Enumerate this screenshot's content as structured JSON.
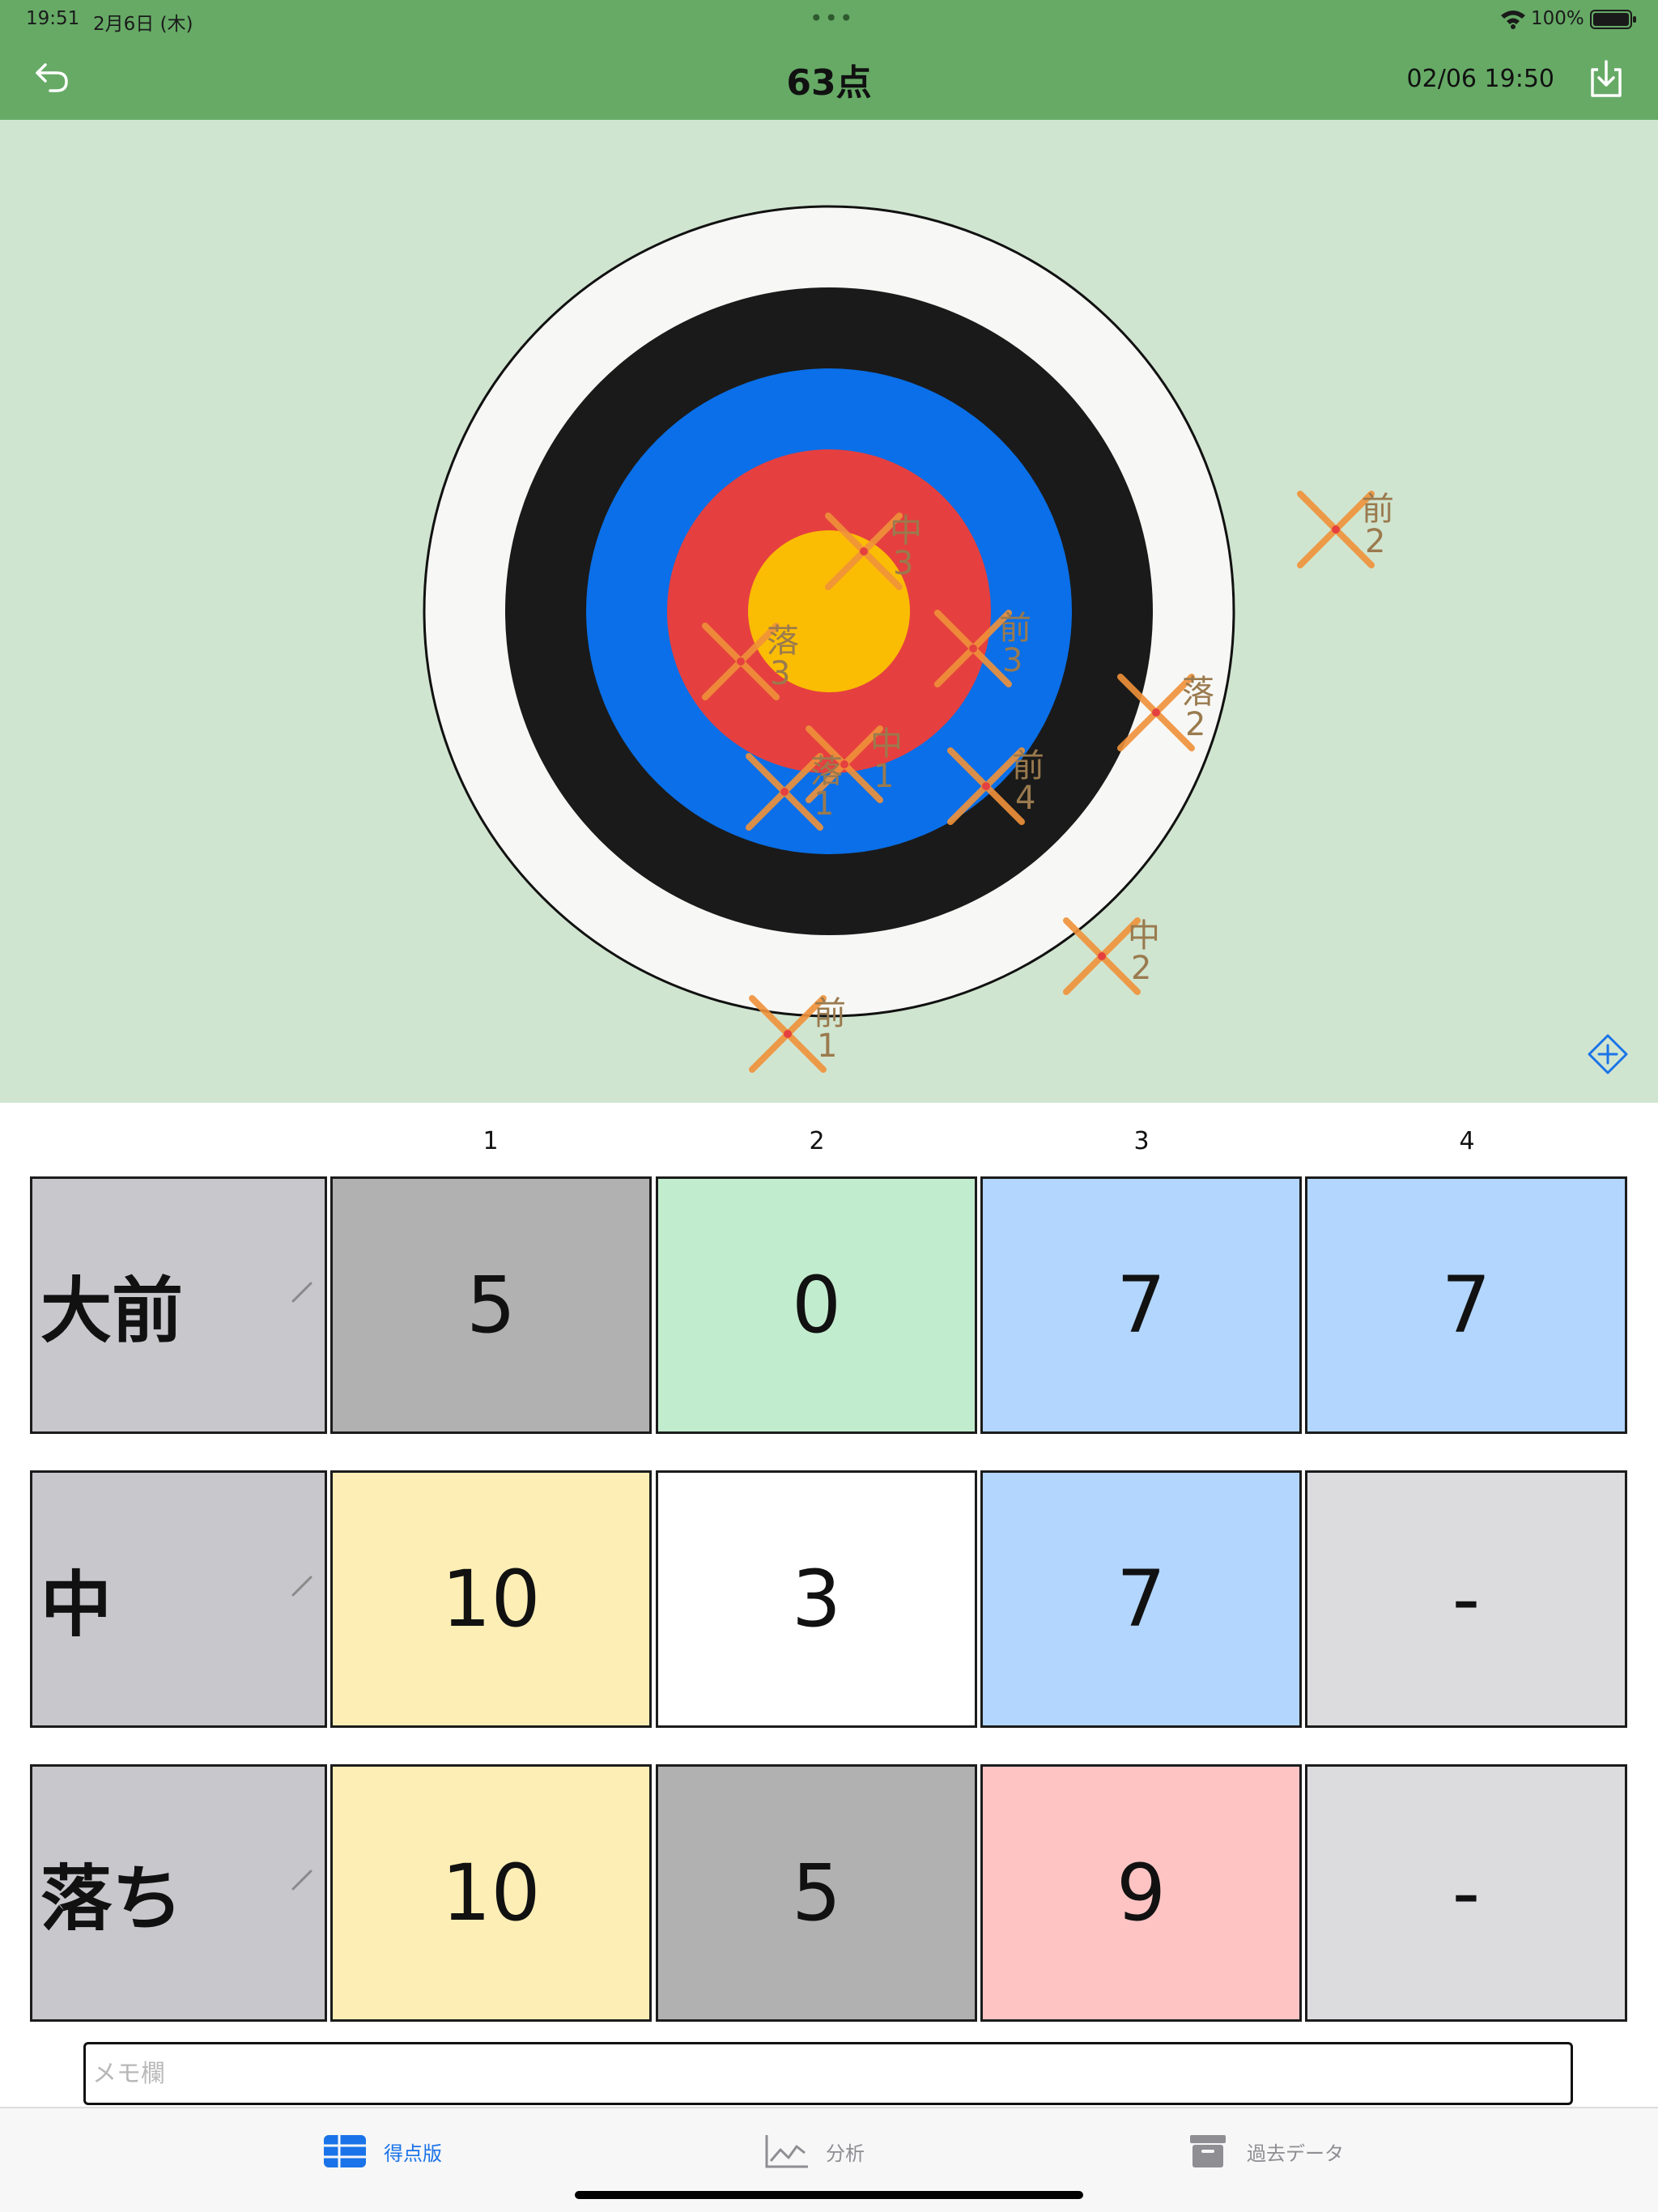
{
  "status_bar": {
    "time": "19:51",
    "date": "2月6日 (木)",
    "dots": "•••",
    "battery_pct": "100%"
  },
  "nav": {
    "title": "63点",
    "datetime": "02/06 19:50"
  },
  "target": {
    "ring_colors": [
      "#f7f8f5",
      "#1a1a1a",
      "#0a6fe8",
      "#e5403f",
      "#fbbc04"
    ],
    "marker_color": "#f0923a",
    "shots": [
      {
        "id": "shot-mae-1",
        "label": "前",
        "number": "1"
      },
      {
        "id": "shot-mae-2",
        "label": "前",
        "number": "2"
      },
      {
        "id": "shot-mae-3",
        "label": "前",
        "number": "3"
      },
      {
        "id": "shot-mae-4",
        "label": "前",
        "number": "4"
      },
      {
        "id": "shot-naka-1",
        "label": "中",
        "number": "1"
      },
      {
        "id": "shot-naka-2",
        "label": "中",
        "number": "2"
      },
      {
        "id": "shot-naka-3",
        "label": "中",
        "number": "3"
      },
      {
        "id": "shot-ochi-1",
        "label": "落",
        "number": "1"
      },
      {
        "id": "shot-ochi-2",
        "label": "落",
        "number": "2"
      },
      {
        "id": "shot-ochi-3",
        "label": "落",
        "number": "3"
      }
    ]
  },
  "score_table": {
    "columns": [
      "1",
      "2",
      "3",
      "4"
    ],
    "rows": [
      {
        "label": "大前",
        "scores": [
          "5",
          "0",
          "7",
          "7"
        ]
      },
      {
        "label": "中",
        "scores": [
          "10",
          "3",
          "7",
          "-"
        ]
      },
      {
        "label": "落ち",
        "scores": [
          "10",
          "5",
          "9",
          "-"
        ]
      }
    ],
    "score_colors": {
      "10": "#fdeeb5",
      "9": "#fec4c4",
      "7": "#b2d6fe",
      "5": "#b1b1b1",
      "3": "#ffffff",
      "0": "#c2ecce",
      "-": "#dcdcde"
    }
  },
  "memo": {
    "placeholder": "メモ欄",
    "value": ""
  },
  "tabs": [
    {
      "label": "得点版",
      "icon": "table-icon",
      "active": true
    },
    {
      "label": "分析",
      "icon": "chart-icon",
      "active": false
    },
    {
      "label": "過去データ",
      "icon": "archive-icon",
      "active": false
    }
  ]
}
